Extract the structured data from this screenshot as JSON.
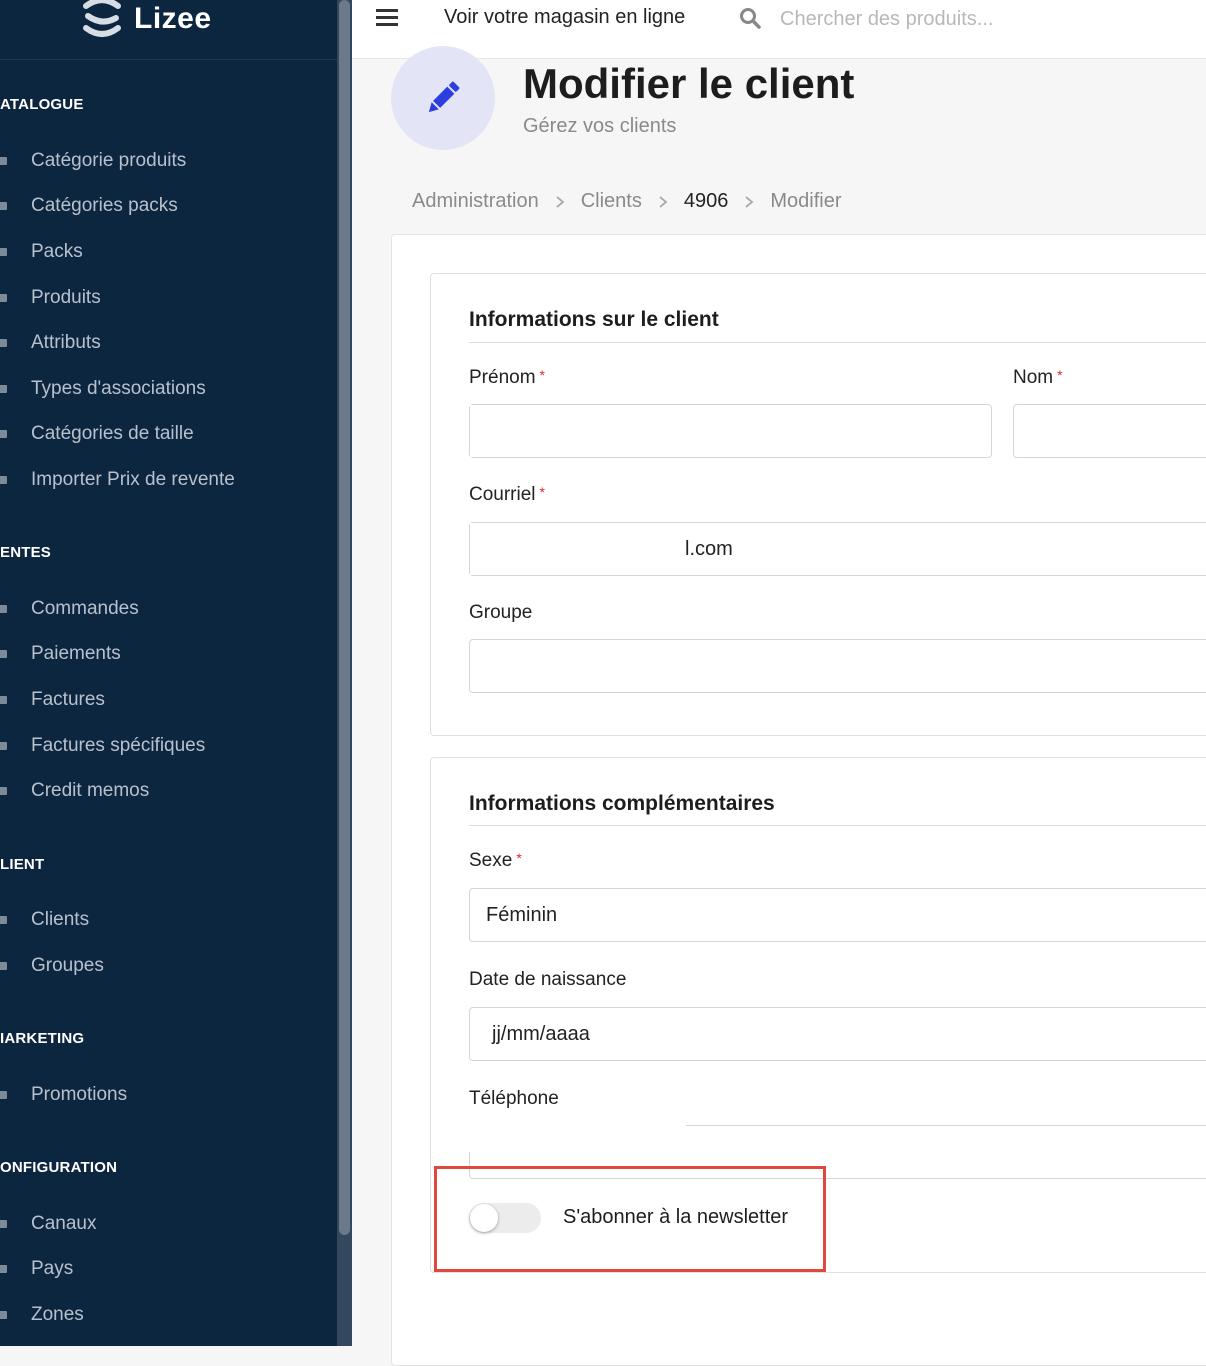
{
  "sidebar": {
    "brand": "Lizee",
    "sections": [
      {
        "title": "ATALOGUE",
        "items": [
          {
            "label": "Catégorie produits",
            "icon": "folder-icon"
          },
          {
            "label": "Catégories packs",
            "icon": "folder-icon"
          },
          {
            "label": "Packs",
            "icon": "cubes-icon"
          },
          {
            "label": "Produits",
            "icon": "cube-icon"
          },
          {
            "label": "Attributs",
            "icon": "cogs-icon"
          },
          {
            "label": "Types d'associations",
            "icon": "list-icon"
          },
          {
            "label": "Catégories de taille",
            "icon": "list-icon"
          },
          {
            "label": "Importer Prix de revente",
            "icon": "cubes-icon"
          }
        ]
      },
      {
        "title": "ENTES",
        "items": [
          {
            "label": "Commandes",
            "icon": "cart-icon"
          },
          {
            "label": "Paiements",
            "icon": "credit-card-icon"
          },
          {
            "label": "Factures",
            "icon": "file-icon"
          },
          {
            "label": "Factures spécifiques",
            "icon": "file-icon"
          },
          {
            "label": "Credit memos",
            "icon": "inbox-icon"
          }
        ]
      },
      {
        "title": "LIENT",
        "items": [
          {
            "label": "Clients",
            "icon": "users-icon"
          },
          {
            "label": "Groupes",
            "icon": "archive-icon"
          }
        ]
      },
      {
        "title": "IARKETING",
        "items": [
          {
            "label": "Promotions",
            "icon": "cart-icon"
          }
        ]
      },
      {
        "title": "ONFIGURATION",
        "items": [
          {
            "label": "Canaux",
            "icon": "share-icon"
          },
          {
            "label": "Pays",
            "icon": "flag-icon"
          },
          {
            "label": "Zones",
            "icon": "globe-icon"
          }
        ]
      }
    ]
  },
  "topbar": {
    "store_link": "Voir votre magasin en ligne",
    "search_placeholder": "Chercher des produits..."
  },
  "header": {
    "title": "Modifier le client",
    "subtitle": "Gérez vos clients"
  },
  "breadcrumb": [
    "Administration",
    "Clients",
    "4906",
    "Modifier"
  ],
  "customer_info": {
    "title": "Informations sur le client",
    "first_name_label": "Prénom",
    "first_name_value": "",
    "last_name_label": "Nom",
    "last_name_value": "",
    "email_label": "Courriel",
    "email_value": "l.com",
    "group_label": "Groupe",
    "group_value": ""
  },
  "extra_info": {
    "title": "Informations complémentaires",
    "gender_label": "Sexe",
    "gender_value": "Féminin",
    "birthdate_label": "Date de naissance",
    "birthdate_placeholder": "jj/mm/aaaa",
    "phone_label": "Téléphone",
    "phone_value": "",
    "newsletter_label": "S'abonner à la newsletter",
    "newsletter_on": false
  },
  "required_mark": "*",
  "colors": {
    "sidebar_bg": "#0d2640",
    "accent": "#2d3ee0",
    "required": "#db2828",
    "highlight": "#e0483e"
  }
}
